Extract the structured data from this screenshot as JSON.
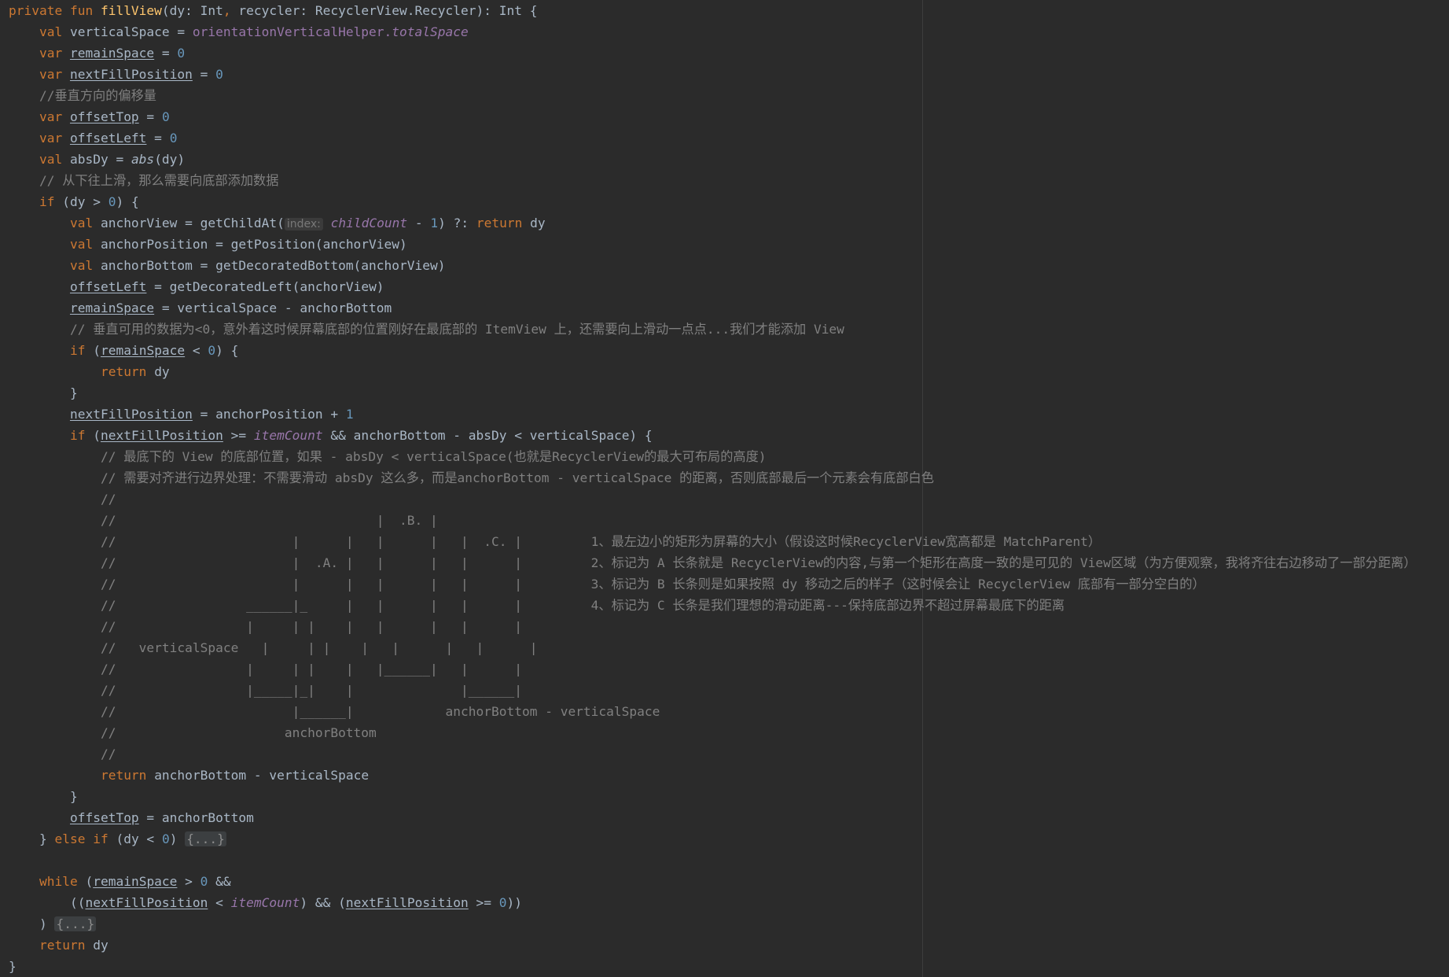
{
  "editor": {
    "background": "#2b2b2b",
    "colors": {
      "default": "#a9b7c6",
      "keyword": "#cc7832",
      "function": "#ffc66d",
      "number": "#6897bb",
      "comment": "#808080",
      "property": "#9876aa"
    },
    "lines": [
      {
        "indent": 0,
        "tokens": [
          [
            "private fun ",
            "kw"
          ],
          [
            "fillView",
            "fn"
          ],
          [
            "(dy: Int",
            ""
          ],
          [
            ", ",
            "kw"
          ],
          [
            "recycler: RecyclerView.Recycler): Int {",
            ""
          ]
        ]
      },
      {
        "indent": 1,
        "tokens": [
          [
            "val ",
            "kw"
          ],
          [
            "verticalSpace = ",
            ""
          ],
          [
            "orientationVerticalHelper.",
            "prop-plain"
          ],
          [
            "totalSpace",
            "prop"
          ]
        ]
      },
      {
        "indent": 1,
        "tokens": [
          [
            "var ",
            "kw"
          ],
          [
            "remainSpace",
            "ul"
          ],
          [
            " = ",
            ""
          ],
          [
            "0",
            "num"
          ]
        ]
      },
      {
        "indent": 1,
        "tokens": [
          [
            "var ",
            "kw"
          ],
          [
            "nextFillPosition",
            "ul"
          ],
          [
            " = ",
            ""
          ],
          [
            "0",
            "num"
          ]
        ]
      },
      {
        "indent": 1,
        "tokens": [
          [
            "//垂直方向的偏移量",
            "cm"
          ]
        ]
      },
      {
        "indent": 1,
        "tokens": [
          [
            "var ",
            "kw"
          ],
          [
            "offsetTop",
            "ul"
          ],
          [
            " = ",
            ""
          ],
          [
            "0",
            "num"
          ]
        ]
      },
      {
        "indent": 1,
        "tokens": [
          [
            "var ",
            "kw"
          ],
          [
            "offsetLeft",
            "ul"
          ],
          [
            " = ",
            ""
          ],
          [
            "0",
            "num"
          ]
        ]
      },
      {
        "indent": 1,
        "tokens": [
          [
            "val ",
            "kw"
          ],
          [
            "absDy = ",
            ""
          ],
          [
            "abs",
            "ital"
          ],
          [
            "(dy)",
            ""
          ]
        ]
      },
      {
        "indent": 1,
        "tokens": [
          [
            "// 从下往上滑，那么需要向底部添加数据",
            "cm"
          ]
        ]
      },
      {
        "indent": 1,
        "tokens": [
          [
            "if ",
            "kw"
          ],
          [
            "(dy > ",
            ""
          ],
          [
            "0",
            "num"
          ],
          [
            ") {",
            ""
          ]
        ]
      },
      {
        "indent": 2,
        "tokens": [
          [
            "val ",
            "kw"
          ],
          [
            "anchorView = getChildAt(",
            ""
          ],
          [
            "index:",
            "hint"
          ],
          [
            " ",
            ""
          ],
          [
            "childCount",
            "prop"
          ],
          [
            " - ",
            ""
          ],
          [
            "1",
            "num"
          ],
          [
            ") ?: ",
            ""
          ],
          [
            "return ",
            "kw"
          ],
          [
            "dy",
            ""
          ]
        ]
      },
      {
        "indent": 2,
        "tokens": [
          [
            "val ",
            "kw"
          ],
          [
            "anchorPosition = getPosition(anchorView)",
            ""
          ]
        ]
      },
      {
        "indent": 2,
        "tokens": [
          [
            "val ",
            "kw"
          ],
          [
            "anchorBottom = getDecoratedBottom(anchorView)",
            ""
          ]
        ]
      },
      {
        "indent": 2,
        "tokens": [
          [
            "offsetLeft",
            "ul"
          ],
          [
            " = getDecoratedLeft(anchorView)",
            ""
          ]
        ]
      },
      {
        "indent": 2,
        "tokens": [
          [
            "remainSpace",
            "ul"
          ],
          [
            " = verticalSpace - anchorBottom",
            ""
          ]
        ]
      },
      {
        "indent": 2,
        "tokens": [
          [
            "// 垂直可用的数据为<0，意外着这时候屏幕底部的位置刚好在最底部的 ItemView 上，还需要向上滑动一点点...我们才能添加 View",
            "cm"
          ]
        ]
      },
      {
        "indent": 2,
        "tokens": [
          [
            "if ",
            "kw"
          ],
          [
            "(",
            ""
          ],
          [
            "remainSpace",
            "ul"
          ],
          [
            " < ",
            ""
          ],
          [
            "0",
            "num"
          ],
          [
            ") {",
            ""
          ]
        ]
      },
      {
        "indent": 3,
        "tokens": [
          [
            "return ",
            "kw"
          ],
          [
            "dy",
            ""
          ]
        ]
      },
      {
        "indent": 2,
        "tokens": [
          [
            "}",
            ""
          ]
        ]
      },
      {
        "indent": 2,
        "tokens": [
          [
            "nextFillPosition",
            "ul"
          ],
          [
            " = anchorPosition + ",
            ""
          ],
          [
            "1",
            "num"
          ]
        ]
      },
      {
        "indent": 2,
        "tokens": [
          [
            "if ",
            "kw"
          ],
          [
            "(",
            ""
          ],
          [
            "nextFillPosition",
            "ul"
          ],
          [
            " >= ",
            ""
          ],
          [
            "itemCount",
            "prop"
          ],
          [
            " && anchorBottom - absDy < verticalSpace) {",
            ""
          ]
        ]
      },
      {
        "indent": 3,
        "tokens": [
          [
            "// 最底下的 View 的底部位置，如果 - absDy < verticalSpace(也就是RecyclerView的最大可布局的高度)",
            "cm"
          ]
        ]
      },
      {
        "indent": 3,
        "tokens": [
          [
            "// 需要对齐进行边界处理：不需要滑动 absDy 这么多，而是anchorBottom - verticalSpace 的距离，否则底部最后一个元素会有底部白色",
            "cm"
          ]
        ]
      },
      {
        "indent": 3,
        "tokens": [
          [
            "//",
            "cm"
          ]
        ]
      },
      {
        "indent": 3,
        "tokens": [
          [
            "//                                  |  .B. |",
            "cm"
          ]
        ]
      },
      {
        "indent": 3,
        "tokens": [
          [
            "//                       |      |   |      |   |  .C. |         1、最左边小的矩形为屏幕的大小（假设这时候RecyclerView宽高都是 MatchParent）",
            "cm"
          ]
        ]
      },
      {
        "indent": 3,
        "tokens": [
          [
            "//                       |  .A. |   |      |   |      |         2、标记为 A 长条就是 RecyclerView的内容,与第一个矩形在高度一致的是可见的 View区域（为方便观察，我将齐往右边移动了一部分距离）",
            "cm"
          ]
        ]
      },
      {
        "indent": 3,
        "tokens": [
          [
            "//                       |      |   |      |   |      |         3、标记为 B 长条则是如果按照 dy 移动之后的样子（这时候会让 RecyclerView 底部有一部分空白的）",
            "cm"
          ]
        ]
      },
      {
        "indent": 3,
        "tokens": [
          [
            "//                 ______|_     |   |      |   |      |         4、标记为 C 长条是我们理想的滑动距离---保持底部边界不超过屏幕最底下的距离",
            "cm"
          ]
        ]
      },
      {
        "indent": 3,
        "tokens": [
          [
            "//                 |     | |    |   |      |   |      |",
            "cm"
          ]
        ]
      },
      {
        "indent": 3,
        "tokens": [
          [
            "//   verticalSpace   |     | |    |   |      |   |      |",
            "cm"
          ]
        ]
      },
      {
        "indent": 3,
        "tokens": [
          [
            "//                 |     | |    |   |______|   |      |",
            "cm"
          ]
        ]
      },
      {
        "indent": 3,
        "tokens": [
          [
            "//                 |_____|_|    |              |______|",
            "cm"
          ]
        ]
      },
      {
        "indent": 3,
        "tokens": [
          [
            "//                       |______|            anchorBottom - verticalSpace",
            "cm"
          ]
        ]
      },
      {
        "indent": 3,
        "tokens": [
          [
            "//                      anchorBottom",
            "cm"
          ]
        ]
      },
      {
        "indent": 3,
        "tokens": [
          [
            "//",
            "cm"
          ]
        ]
      },
      {
        "indent": 3,
        "tokens": [
          [
            "return ",
            "kw"
          ],
          [
            "anchorBottom - verticalSpace",
            ""
          ]
        ]
      },
      {
        "indent": 2,
        "tokens": [
          [
            "}",
            ""
          ]
        ]
      },
      {
        "indent": 2,
        "tokens": [
          [
            "offsetTop",
            "ul"
          ],
          [
            " = anchorBottom",
            ""
          ]
        ]
      },
      {
        "indent": 1,
        "tokens": [
          [
            "} ",
            ""
          ],
          [
            "else if ",
            "kw"
          ],
          [
            "(dy < ",
            ""
          ],
          [
            "0",
            "num"
          ],
          [
            ") ",
            ""
          ],
          [
            "{...}",
            "fold"
          ]
        ]
      },
      {
        "indent": 0,
        "tokens": []
      },
      {
        "indent": 1,
        "tokens": [
          [
            "while ",
            "kw"
          ],
          [
            "(",
            ""
          ],
          [
            "remainSpace",
            "ul"
          ],
          [
            " > ",
            ""
          ],
          [
            "0",
            "num"
          ],
          [
            " &&",
            ""
          ]
        ]
      },
      {
        "indent": 2,
        "tokens": [
          [
            "((",
            ""
          ],
          [
            "nextFillPosition",
            "ul"
          ],
          [
            " < ",
            ""
          ],
          [
            "itemCount",
            "prop"
          ],
          [
            ") && (",
            ""
          ],
          [
            "nextFillPosition",
            "ul"
          ],
          [
            " >= ",
            ""
          ],
          [
            "0",
            "num"
          ],
          [
            "))",
            ""
          ]
        ]
      },
      {
        "indent": 1,
        "tokens": [
          [
            ") ",
            ""
          ],
          [
            "{...}",
            "fold"
          ]
        ]
      },
      {
        "indent": 1,
        "tokens": [
          [
            "return ",
            "kw"
          ],
          [
            "dy",
            ""
          ]
        ]
      },
      {
        "indent": 0,
        "tokens": [
          [
            "}",
            ""
          ]
        ]
      }
    ]
  }
}
